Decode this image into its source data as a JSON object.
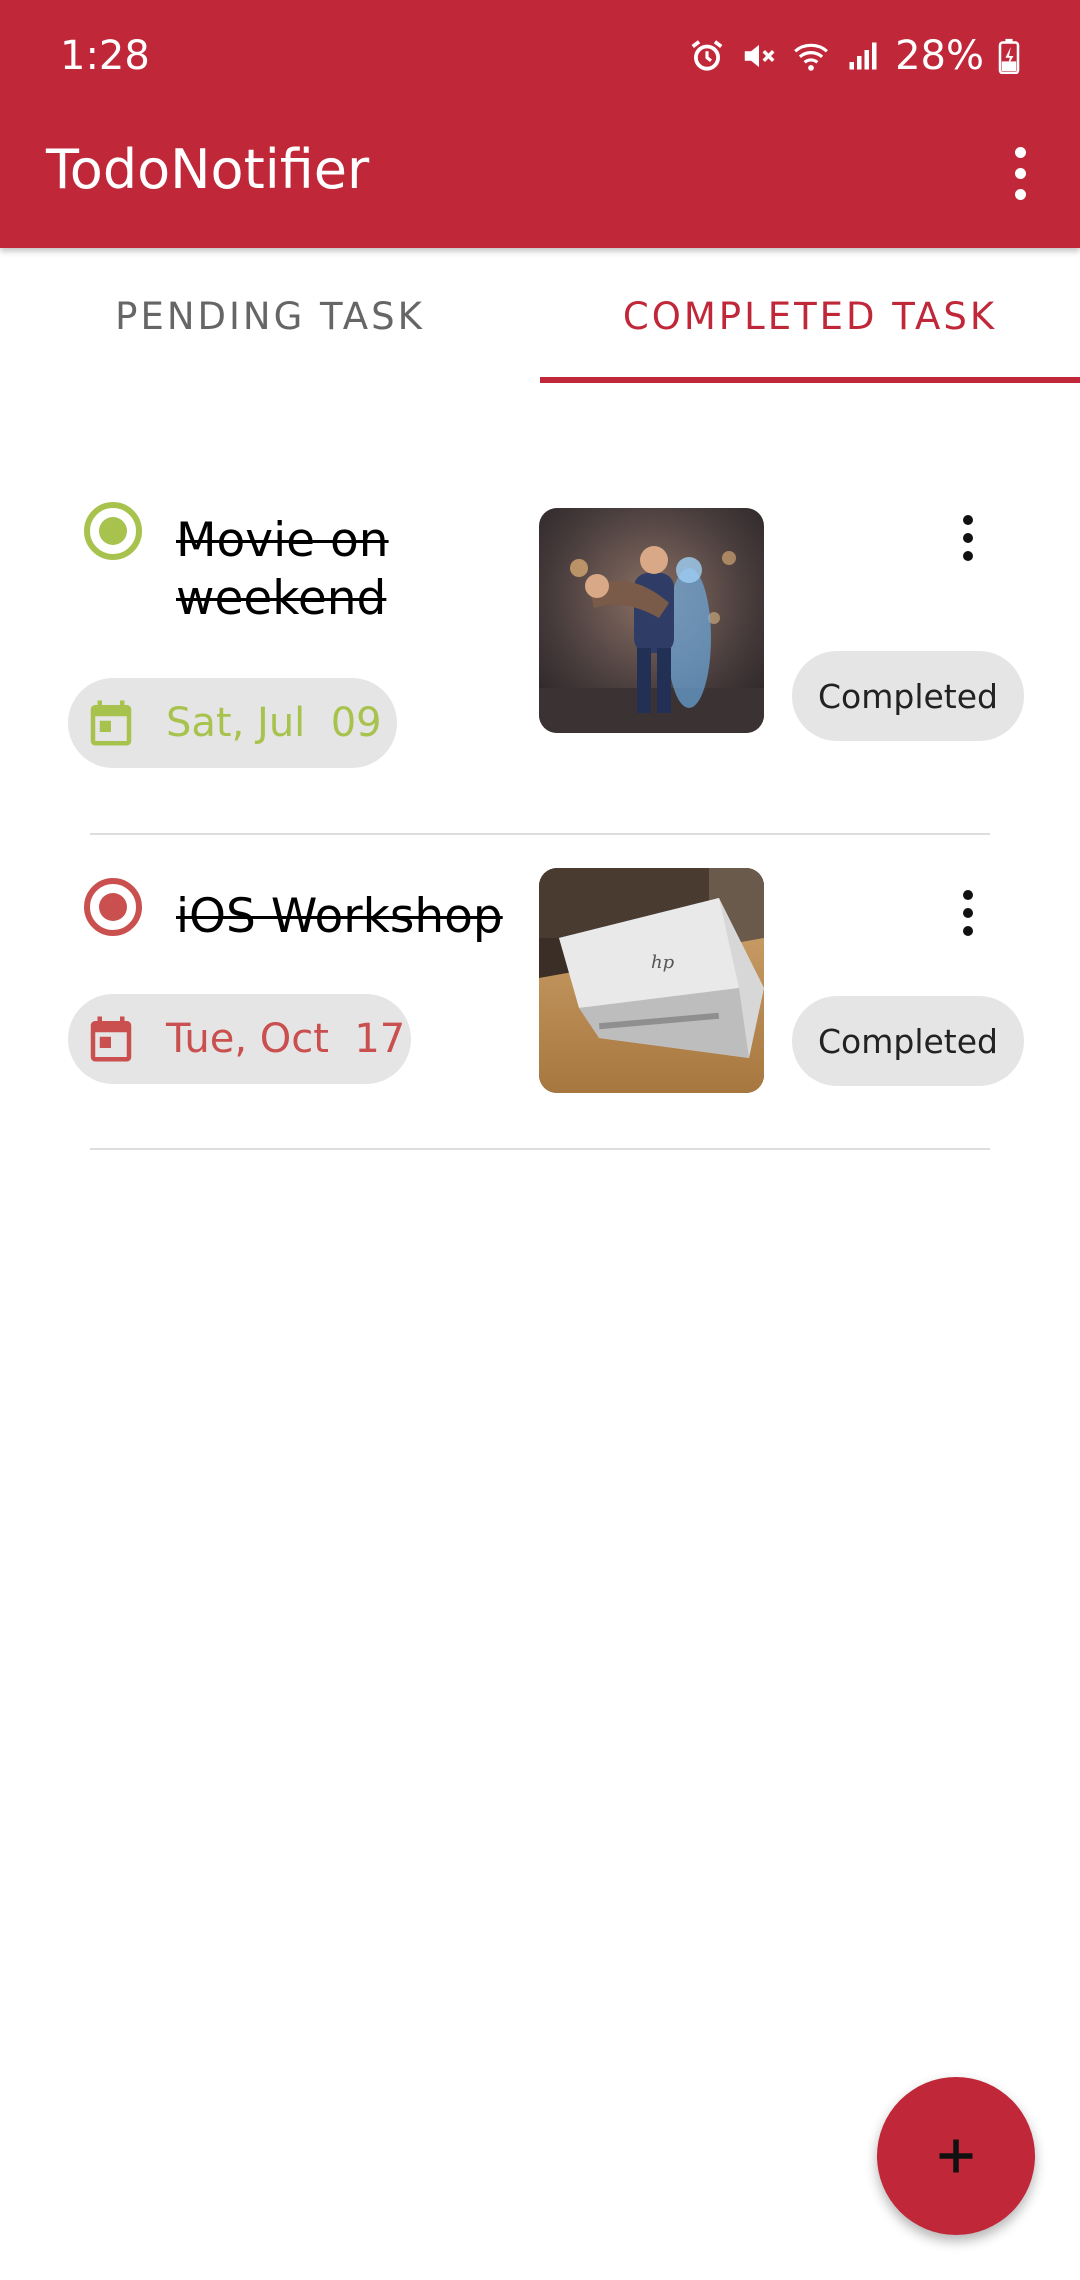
{
  "status_bar": {
    "time": "1:28",
    "battery": "28%",
    "icons": [
      "alarm-icon",
      "mute-icon",
      "wifi-icon",
      "signal-icon",
      "battery-charging-icon"
    ]
  },
  "app_bar": {
    "title": "TodoNotifier",
    "menu_icon": "more-vert-icon"
  },
  "tabs": [
    {
      "label": "PENDING TASK",
      "selected": false
    },
    {
      "label": "COMPLETED TASK",
      "selected": true
    }
  ],
  "tasks": [
    {
      "title": "Movie on weekend",
      "date": "Sat, Jul  09",
      "status": "Completed",
      "accent": "#a8c34d",
      "thumbnail": "movie-poster-image"
    },
    {
      "title": "iOS Workshop",
      "date": "Tue, Oct  17",
      "status": "Completed",
      "accent": "#c9504e",
      "thumbnail": "laptop-image"
    }
  ],
  "fab": {
    "icon": "plus-icon"
  },
  "colors": {
    "primary": "#c0283a",
    "chip_background": "#e5e5e5",
    "tab_inactive": "#666666"
  }
}
